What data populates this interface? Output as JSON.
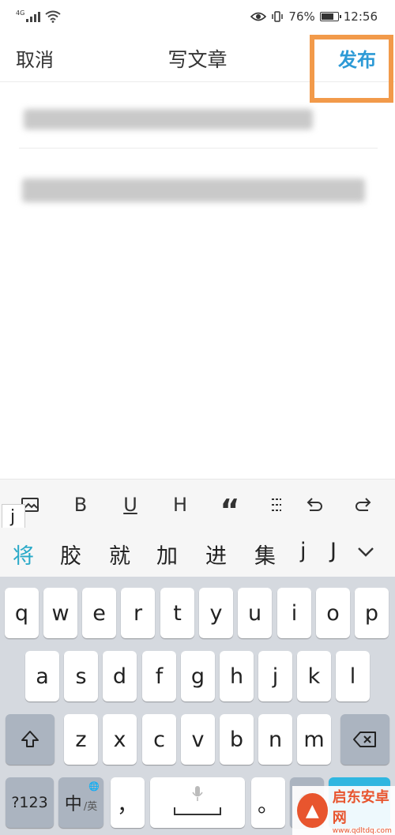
{
  "status_bar": {
    "network_type": "4G",
    "battery_percent": "76%",
    "battery_level": 0.76,
    "time": "12:56",
    "icons": [
      "signal-icon",
      "wifi-icon",
      "eye-icon",
      "vibrate-icon",
      "battery-icon"
    ]
  },
  "header": {
    "cancel_label": "取消",
    "title": "写文章",
    "publish_label": "发布",
    "highlight_color": "#f29a4a",
    "publish_color": "#2d9ad6"
  },
  "editor": {
    "title_text": "",
    "body_text": ""
  },
  "toolbar": {
    "composing_letter": "j",
    "bold_label": "B",
    "underline_label": "U",
    "heading_label": "H",
    "quote_label": "“",
    "items": [
      "image-icon",
      "bold-icon",
      "underline-icon",
      "heading-icon",
      "quote-icon",
      "list-icon",
      "undo-icon",
      "redo-icon"
    ]
  },
  "candidates": {
    "items": [
      "将",
      "胶",
      "就",
      "加",
      "进",
      "集",
      "j",
      "J"
    ],
    "accent_color": "#29a9c8"
  },
  "keyboard": {
    "row1": [
      "q",
      "w",
      "e",
      "r",
      "t",
      "y",
      "u",
      "i",
      "o",
      "p"
    ],
    "row2": [
      "a",
      "s",
      "d",
      "f",
      "g",
      "h",
      "j",
      "k",
      "l"
    ],
    "row3": [
      "z",
      "x",
      "c",
      "v",
      "b",
      "n",
      "m"
    ],
    "num_label": "?123",
    "lang_label": "中",
    "lang_sub_label": "/英",
    "comma_label": "，",
    "period_label": "。"
  },
  "watermark": {
    "name": "启东安卓网",
    "url": "www.qdltdq.com"
  }
}
